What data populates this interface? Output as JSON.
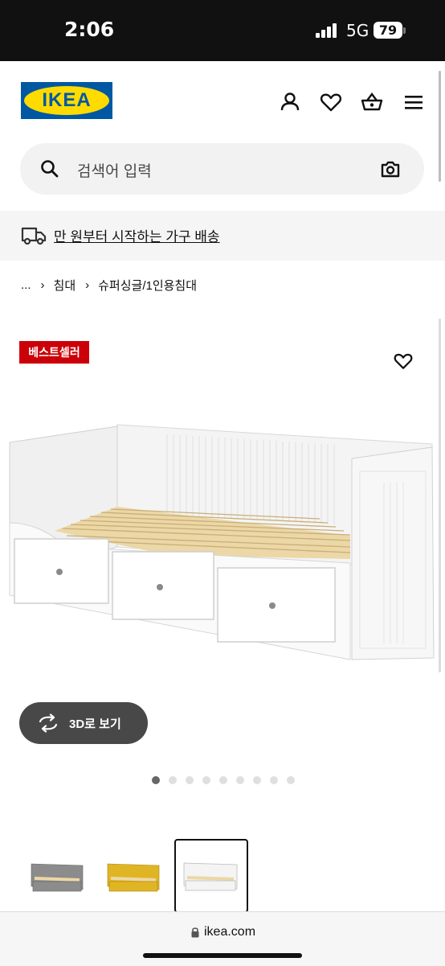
{
  "status_bar": {
    "time": "2:06",
    "network": "5G",
    "battery": "79"
  },
  "header": {
    "logo_text": "IKEA",
    "icons": [
      "profile-icon",
      "heart-icon",
      "basket-icon",
      "menu-icon"
    ]
  },
  "search": {
    "placeholder": "검색어 입력",
    "icons": [
      "search-icon",
      "camera-icon"
    ]
  },
  "banner": {
    "text": "만 원부터 시작하는 가구 배송",
    "icon": "truck-icon"
  },
  "breadcrumb": {
    "items": [
      "...",
      "침대",
      "슈퍼싱글/1인용침대"
    ]
  },
  "product": {
    "badge": "베스트셀러",
    "view_3d_label": "3D로 보기",
    "image_count": 9,
    "active_image": 1,
    "thumbnails": [
      {
        "color_hex": "#8c8c8c"
      },
      {
        "color_hex": "#e0b524"
      },
      {
        "color_hex": "#f4f4f4",
        "selected": true
      }
    ]
  },
  "browser": {
    "url": "ikea.com"
  },
  "colors": {
    "ikea_blue": "#0058a3",
    "ikea_yellow": "#ffdb00",
    "badge_red": "#cc0008"
  }
}
